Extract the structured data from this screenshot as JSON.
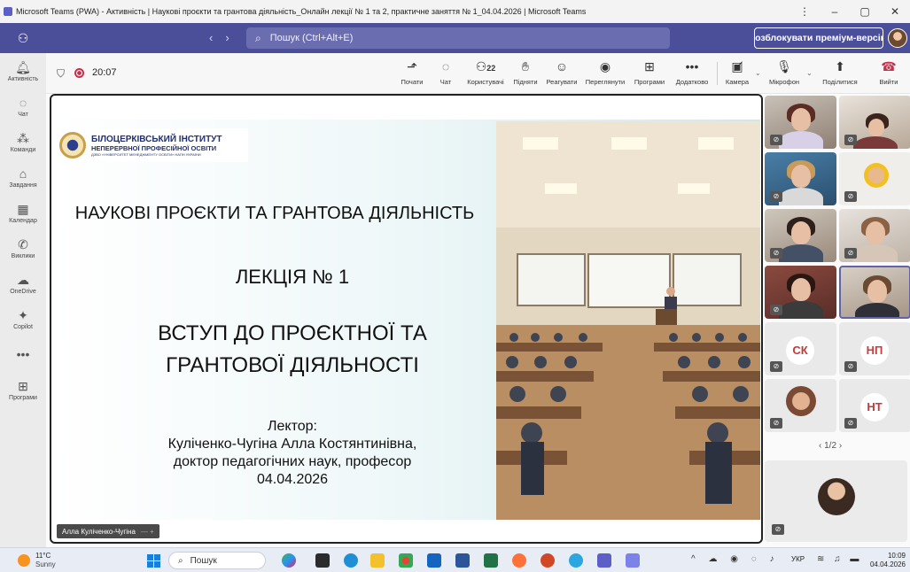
{
  "window": {
    "title": "Microsoft Teams (PWA) - Активність | Наукові проєкти та грантова діяльність_Онлайн лекції № 1 та 2, практичне заняття № 1_04.04.2026 | Microsoft Teams",
    "controls": [
      "⋮",
      "–",
      "▢",
      "✕"
    ]
  },
  "header": {
    "search_placeholder": "Пошук (Ctrl+Alt+E)",
    "premium_button": "Розблокувати преміум-версію"
  },
  "rail": [
    {
      "icon": "bell-icon",
      "glyph": "🔔",
      "label": "Активність"
    },
    {
      "icon": "chat-icon",
      "glyph": "💬",
      "label": "Чат"
    },
    {
      "icon": "teams-icon",
      "glyph": "👥",
      "label": "Команди"
    },
    {
      "icon": "assignments-icon",
      "glyph": "📋",
      "label": "Завдання"
    },
    {
      "icon": "calendar-icon",
      "glyph": "📅",
      "label": "Календар"
    },
    {
      "icon": "calls-icon",
      "glyph": "📞",
      "label": "Виклики"
    },
    {
      "icon": "onedrive-icon",
      "glyph": "☁",
      "label": "OneDrive"
    },
    {
      "icon": "copilot-icon",
      "glyph": "✦",
      "label": "Copilot"
    },
    {
      "icon": "more-icon",
      "glyph": "•••",
      "label": ""
    },
    {
      "icon": "apps-icon",
      "glyph": "⊞",
      "label": "Програми"
    }
  ],
  "meeting": {
    "timer": "20:07",
    "participants_count": "22",
    "toolbar": [
      {
        "icon": "start-icon",
        "glyph": "⤴",
        "label": "Почати"
      },
      {
        "icon": "chat-icon",
        "glyph": "💬",
        "label": "Чат"
      },
      {
        "icon": "people-icon",
        "glyph": "👥",
        "label": "Користувачі"
      },
      {
        "icon": "raise-hand-icon",
        "glyph": "✋",
        "label": "Підняти"
      },
      {
        "icon": "react-icon",
        "glyph": "☺",
        "label": "Реагувати"
      },
      {
        "icon": "view-icon",
        "glyph": "◉",
        "label": "Переглянути"
      },
      {
        "icon": "apps-icon",
        "glyph": "⊞",
        "label": "Програми"
      },
      {
        "icon": "more-icon",
        "glyph": "•••",
        "label": "Додатково"
      },
      {
        "icon": "camera-off-icon",
        "glyph": "📷",
        "label": "Камера"
      },
      {
        "icon": "mic-off-icon",
        "glyph": "🎤",
        "label": "Мікрофон"
      },
      {
        "icon": "share-icon",
        "glyph": "⬆",
        "label": "Поділитися"
      },
      {
        "icon": "leave-icon",
        "glyph": "☎",
        "label": "Вийти"
      }
    ]
  },
  "slide": {
    "institute_line1": "БІЛОЦЕРКІВСЬКИЙ ІНСТИТУТ",
    "institute_line2": "НЕПЕРЕРВНОЇ ПРОФЕСІЙНОЇ ОСВІТИ",
    "institute_line3": "ДЗВО «УНІВЕРСИТЕТ МЕНЕДЖМЕНТУ ОСВІТИ» НАПН УКРАЇНИ",
    "title": "НАУКОВІ ПРОЄКТИ ТА ГРАНТОВА ДІЯЛЬНІСТЬ",
    "lecture": "ЛЕКЦІЯ № 1",
    "subtitle_line1": "ВСТУП ДО ПРОЄКТНОЇ ТА",
    "subtitle_line2": "ГРАНТОВОЇ ДІЯЛЬНОСТІ",
    "lecturer_label": "Лектор:",
    "lecturer_name": "Куліченко-Чугіна Алла Костянтинівна,",
    "lecturer_degree": "доктор педагогічних наук, професор",
    "date": "04.04.2026"
  },
  "presenter": {
    "name": "Алла Куліченко-Чугіна",
    "extra": "— +"
  },
  "participants": {
    "initials": [
      "СК",
      "НП",
      "НТ"
    ],
    "page": "1/2",
    "colors": {
      "sk": "#c23a3a",
      "np": "#cf3b3b",
      "nt": "#c23a3a"
    }
  },
  "taskbar": {
    "temperature": "11°C",
    "condition": "Sunny",
    "search_placeholder": "Пошук",
    "tray_lang": "УКР",
    "time": "10:09",
    "date": "04.04.2026"
  }
}
